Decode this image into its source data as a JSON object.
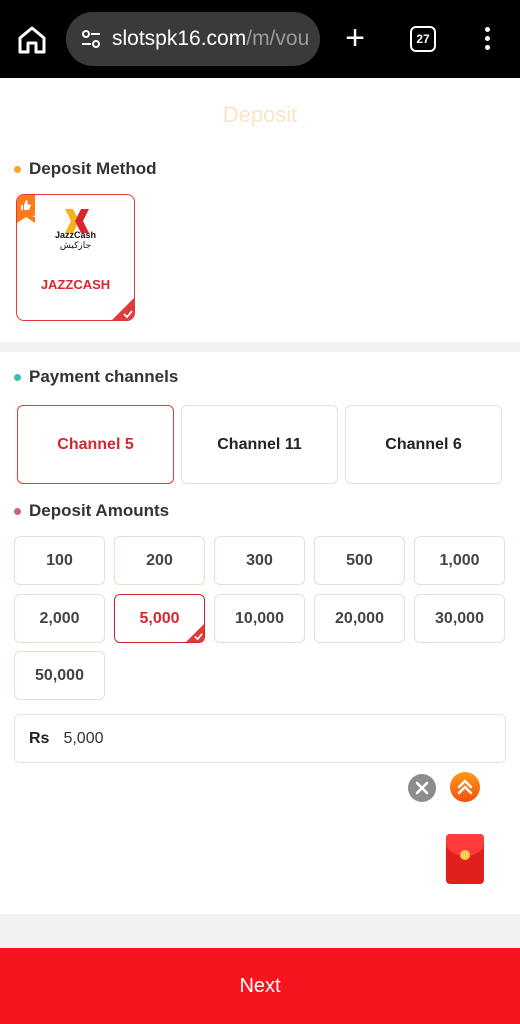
{
  "browser": {
    "url_host": "slotspk16.com",
    "url_path": "/m/vou",
    "tab_count": "27"
  },
  "page": {
    "title": "Deposit"
  },
  "deposit_method": {
    "heading": "Deposit Method",
    "dot_color": "#f5a623",
    "method": {
      "logo_text_en": "JazzCash",
      "logo_text_ur": "جازکیش",
      "label": "JAZZCASH",
      "selected": true
    }
  },
  "payment_channels": {
    "heading": "Payment channels",
    "dot_color": "#3cc0b5",
    "channels": [
      {
        "label": "Channel 5",
        "selected": true
      },
      {
        "label": "Channel 11",
        "selected": false
      },
      {
        "label": "Channel 6",
        "selected": false
      }
    ]
  },
  "deposit_amounts": {
    "heading": "Deposit Amounts",
    "dot_color": "#c9657a",
    "options": [
      "100",
      "200",
      "300",
      "500",
      "1,000",
      "2,000",
      "5,000",
      "10,000",
      "20,000",
      "30,000",
      "50,000"
    ],
    "selected": "5,000"
  },
  "amount_input": {
    "currency": "Rs",
    "value": "5,000"
  },
  "actions": {
    "next_label": "Next"
  },
  "colors": {
    "accent_red": "#e23a3a",
    "next_button": "#f5151f"
  }
}
